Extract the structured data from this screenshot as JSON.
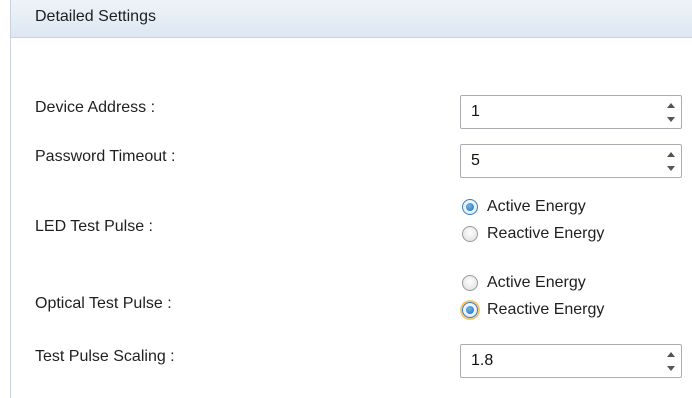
{
  "panel": {
    "title": "Detailed Settings"
  },
  "fields": {
    "device_address": {
      "label": "Device Address :",
      "value": "1"
    },
    "password_timeout": {
      "label": "Password Timeout :",
      "value": "5"
    },
    "led_test_pulse": {
      "label": "LED Test Pulse :",
      "options": [
        "Active Energy",
        "Reactive Energy"
      ],
      "selected": "Active Energy"
    },
    "optical_test_pulse": {
      "label": "Optical Test Pulse :",
      "options": [
        "Active Energy",
        "Reactive Energy"
      ],
      "selected": "Reactive Energy"
    },
    "test_pulse_scaling": {
      "label": "Test Pulse Scaling :",
      "value": "1.8"
    }
  },
  "icons": {
    "spin_up": "chevron-up-icon",
    "spin_down": "chevron-down-icon"
  }
}
